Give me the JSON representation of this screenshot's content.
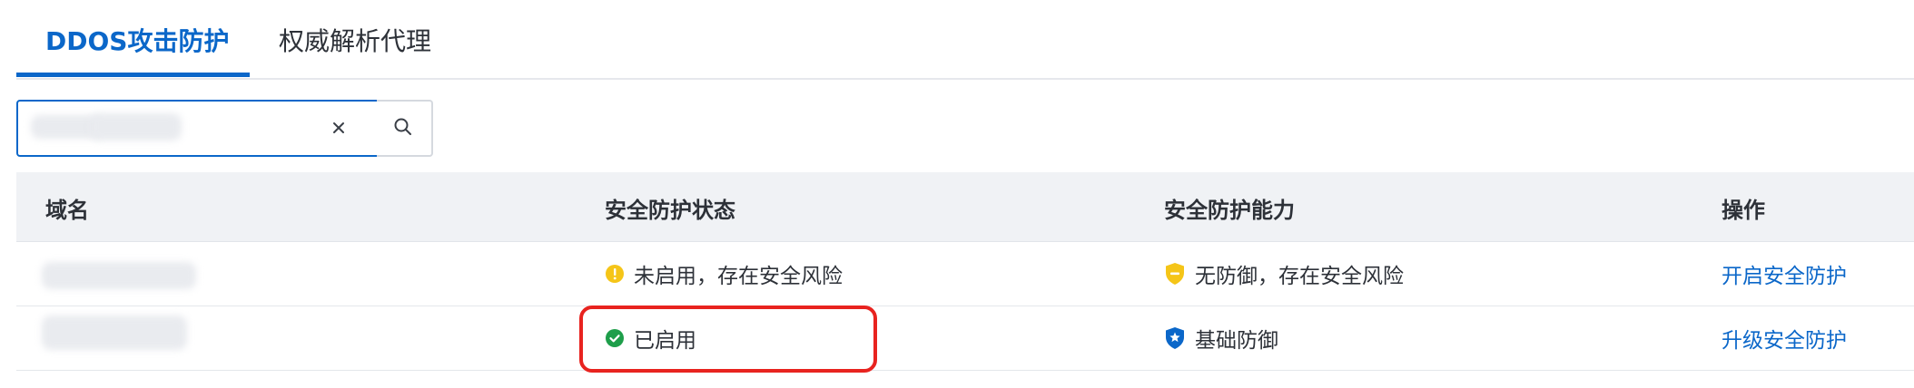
{
  "tabs": [
    {
      "label": "DDOS攻击防护",
      "active": true
    },
    {
      "label": "权威解析代理",
      "active": false
    }
  ],
  "search": {
    "value": "",
    "placeholder": ""
  },
  "table": {
    "headers": [
      "域名",
      "安全防护状态",
      "安全防护能力",
      "操作"
    ],
    "rows": [
      {
        "domain": "",
        "status": "未启用，存在安全风险",
        "status_icon": "warning-circle-icon",
        "capability": "无防御，存在安全风险",
        "capability_icon": "shield-minus-icon",
        "action": "开启安全防护"
      },
      {
        "domain": "",
        "status": "已启用",
        "status_icon": "check-circle-icon",
        "capability": "基础防御",
        "capability_icon": "shield-star-icon",
        "action": "升级安全防护"
      }
    ]
  },
  "colors": {
    "accent": "#0b67c9",
    "warning": "#f5c518",
    "success": "#1e9e4a",
    "highlight": "#e8231f"
  }
}
